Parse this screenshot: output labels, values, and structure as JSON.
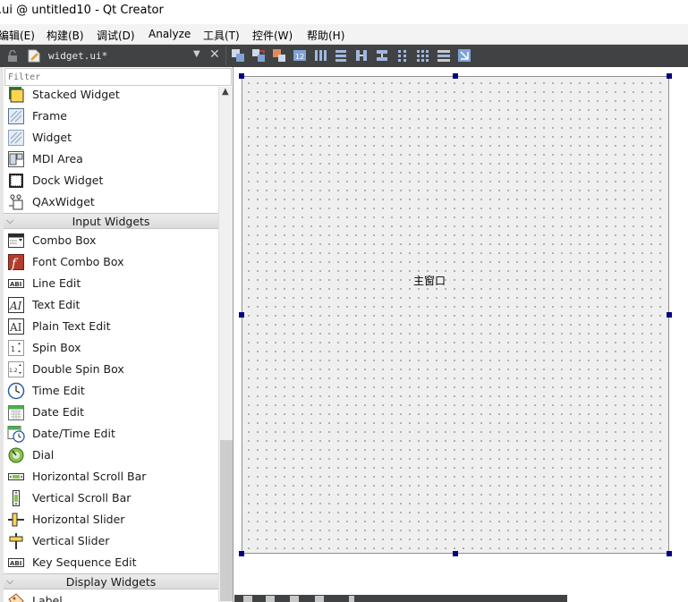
{
  "window": {
    "title": ".ui @ untitled10 - Qt Creator"
  },
  "menu": [
    "编辑(E)",
    "构建(B)",
    "调试(D)",
    "Analyze",
    "工具(T)",
    "控件(W)",
    "帮助(H)"
  ],
  "editor": {
    "file_name": "widget.ui*",
    "dropdown_icon": "chevron-down-icon",
    "close_icon": "close-icon"
  },
  "designer_toolbar": {
    "buttons": [
      "edit-widgets-icon",
      "edit-signals-slots-icon",
      "edit-buddies-icon",
      "edit-tab-order-icon",
      "layout-horizontal-icon",
      "layout-vertical-icon",
      "layout-horizontal-splitter-icon",
      "layout-vertical-splitter-icon",
      "layout-form-icon",
      "layout-grid-icon",
      "break-layout-icon",
      "adjust-size-icon"
    ]
  },
  "widget_box": {
    "filter_placeholder": "Filter",
    "containers_tail": [
      {
        "label": "Stacked Widget",
        "icon": "stacked-widget-icon"
      },
      {
        "label": "Frame",
        "icon": "frame-icon"
      },
      {
        "label": "Widget",
        "icon": "widget-icon"
      },
      {
        "label": "MDI Area",
        "icon": "mdi-area-icon"
      },
      {
        "label": "Dock Widget",
        "icon": "dock-widget-icon"
      },
      {
        "label": "QAxWidget",
        "icon": "qaxwidget-icon"
      }
    ],
    "input_header": "Input Widgets",
    "input_widgets": [
      {
        "label": "Combo Box",
        "icon": "combo-box-icon"
      },
      {
        "label": "Font Combo Box",
        "icon": "font-combo-box-icon"
      },
      {
        "label": "Line Edit",
        "icon": "line-edit-icon"
      },
      {
        "label": "Text Edit",
        "icon": "text-edit-icon"
      },
      {
        "label": "Plain Text Edit",
        "icon": "plain-text-edit-icon"
      },
      {
        "label": "Spin Box",
        "icon": "spin-box-icon"
      },
      {
        "label": "Double Spin Box",
        "icon": "double-spin-box-icon"
      },
      {
        "label": "Time Edit",
        "icon": "time-edit-icon"
      },
      {
        "label": "Date Edit",
        "icon": "date-edit-icon"
      },
      {
        "label": "Date/Time Edit",
        "icon": "date-time-edit-icon"
      },
      {
        "label": "Dial",
        "icon": "dial-icon"
      },
      {
        "label": "Horizontal Scroll Bar",
        "icon": "horizontal-scroll-bar-icon"
      },
      {
        "label": "Vertical Scroll Bar",
        "icon": "vertical-scroll-bar-icon"
      },
      {
        "label": "Horizontal Slider",
        "icon": "horizontal-slider-icon"
      },
      {
        "label": "Vertical Slider",
        "icon": "vertical-slider-icon"
      },
      {
        "label": "Key Sequence Edit",
        "icon": "key-sequence-edit-icon"
      }
    ],
    "display_header": "Display Widgets",
    "display_widgets": [
      {
        "label": "Label",
        "icon": "label-icon"
      }
    ]
  },
  "form": {
    "label": "主窗口"
  },
  "colors": {
    "toolbar_bg": "#404244",
    "form_bg": "#efefef",
    "handle": "#000080"
  }
}
